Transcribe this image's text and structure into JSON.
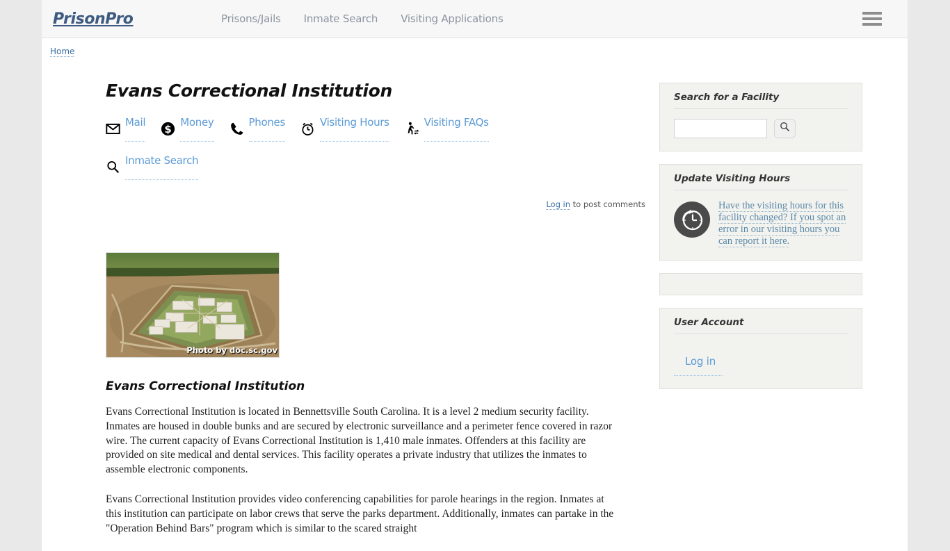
{
  "site": {
    "brand": "PrisonPro",
    "nav": [
      {
        "label": "Prisons/Jails"
      },
      {
        "label": "Inmate Search"
      },
      {
        "label": "Visiting Applications"
      }
    ],
    "menu_icon": "hamburger-menu-icon"
  },
  "breadcrumb": {
    "home": "Home"
  },
  "main": {
    "page_title": "Evans Correctional Institution",
    "icon_links": [
      {
        "label": "Mail",
        "icon": "envelope-icon"
      },
      {
        "label": "Money",
        "icon": "dollar-circle-icon"
      },
      {
        "label": "Phones",
        "icon": "phone-icon"
      },
      {
        "label": "Visiting Hours",
        "icon": "alarm-clock-icon"
      },
      {
        "label": "Visiting FAQs",
        "icon": "walking-person-icon"
      },
      {
        "label": "Inmate Search",
        "icon": "magnifier-icon"
      }
    ],
    "comment_login_label": "Log in",
    "comment_note_rest": " to post comments",
    "photo_credit": "Photo by doc.sc.gov",
    "photo_alt": "aerial-view-of-evans-correctional-institution",
    "body_title": "Evans Correctional Institution",
    "paragraph_1": "Evans Correctional Institution is located in Bennettsville South Carolina.  It is a level 2 medium security facility.  Inmates are housed in double bunks and are secured by electronic surveillance and a perimeter fence covered in razor wire.  The current capacity of Evans Correctional Institution is 1,410 male inmates.  Offenders at this facility are provided on site medical and dental services.  This facility operates a private industry that utilizes the inmates to assemble electronic components.",
    "paragraph_2": "Evans Correctional Institution provides video conferencing capabilities for parole hearings in the region.  Inmates at this institution can participate on labor crews that serve the parks department.  Additionally, inmates can partake in the \"Operation Behind Bars\" program which is similar to the scared straight"
  },
  "sidebar": {
    "search_block": {
      "title": "Search for a Facility",
      "input_value": "",
      "input_placeholder": "",
      "button_icon": "search-icon"
    },
    "update_block": {
      "title": "Update Visiting Hours",
      "icon": "clock-refresh-icon",
      "link_text": "Have the visiting hours for this facility changed?  If you spot an error in our visiting hours you can report it here."
    },
    "user_block": {
      "title": "User Account",
      "login_label": "Log in"
    }
  },
  "colors": {
    "brand": "#3d5a80",
    "link_blue": "#5b9bd5",
    "breadcrumb_link": "#3a6ea5",
    "page_bg": "#e9e9e9",
    "content_bg": "#ffffff",
    "sidebar_block_bg": "#f2f2ef",
    "header_bg": "#f7f7f7"
  }
}
